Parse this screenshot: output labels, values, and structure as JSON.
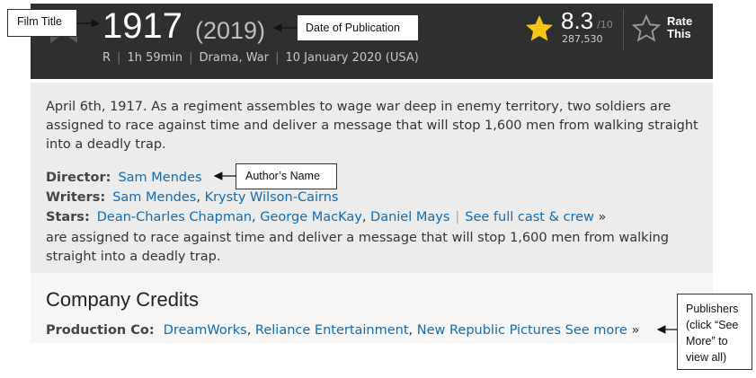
{
  "header": {
    "title": "1917",
    "year": "(2019)",
    "meta": {
      "rating_cert": "R",
      "duration": "1h 59min",
      "genres": "Drama, War",
      "release": "10 January 2020 (USA)",
      "separator": "|"
    },
    "rating": {
      "value": "8.3",
      "max": "/10",
      "count": "287,530"
    },
    "rate_label_1": "Rate",
    "rate_label_2": "This"
  },
  "plot": {
    "summary": "April 6th, 1917. As a regiment assembles to wage war deep in enemy territory, two soldiers are assigned to race against time and deliver a message that will stop 1,600 men from walking straight into a deadly trap.",
    "director_label": "Director:",
    "director": "Sam Mendes",
    "writers_label": "Writers:",
    "writers": [
      "Sam Mendes",
      "Krysty Wilson-Cairns"
    ],
    "stars_label": "Stars:",
    "stars": [
      "Dean-Charles Chapman",
      "George MacKay",
      "Daniel Mays"
    ],
    "see_full": "See full cast & crew",
    "see_full_arrow": "»",
    "bar": "|",
    "summary_repeat": "are assigned to race against time and deliver a message that will stop 1,600 men from walking straight into a deadly trap."
  },
  "company": {
    "heading": "Company Credits",
    "production_label": "Production Co:",
    "companies": [
      "DreamWorks",
      "Reliance Entertainment",
      "New Republic Pictures"
    ],
    "see_more": "See more",
    "see_more_arrow": "»"
  },
  "annotations": {
    "film_title": "Film Title",
    "date": "Date of Publication",
    "author": "Author’s Name",
    "publishers": "Publishers (click “See More” to view all)"
  },
  "colors": {
    "header_bg": "#2f2f2f",
    "star": "#f5c518",
    "link": "#136cb2"
  }
}
